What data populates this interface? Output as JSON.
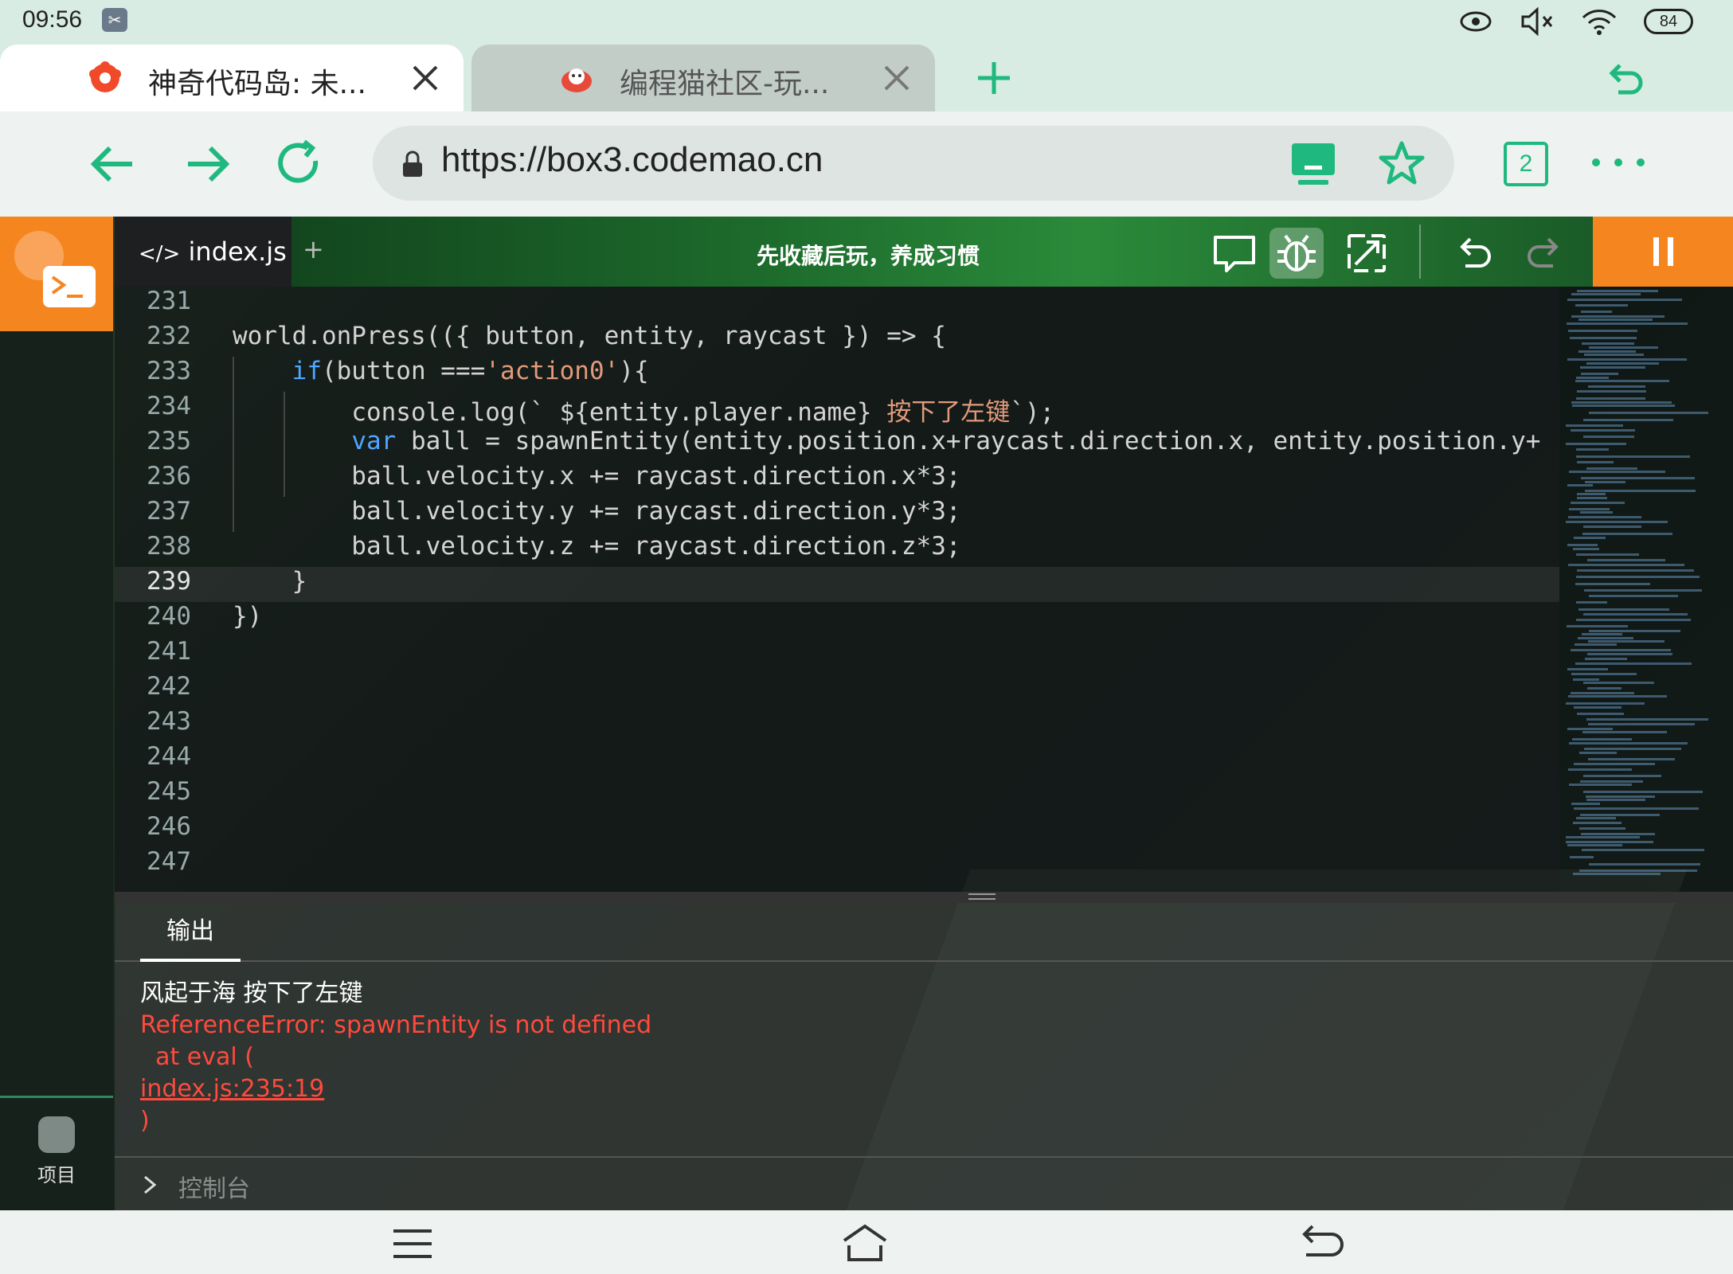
{
  "status_bar": {
    "time": "09:56",
    "battery": "84"
  },
  "tabs": [
    {
      "title": "神奇代码岛: 未...",
      "active": true
    },
    {
      "title": "编程猫社区-玩...",
      "active": false
    }
  ],
  "address_bar": {
    "url": "https://box3.codemao.cn",
    "tab_count": "2"
  },
  "editor": {
    "file_tab": "index.js",
    "new_tab_label": "+",
    "slogan": "先收藏后玩，养成习惯",
    "lines": [
      {
        "no": "231",
        "code": ""
      },
      {
        "no": "232",
        "code": "world.onPress(({ button, entity, raycast }) => {"
      },
      {
        "no": "233",
        "kw": "if",
        "pre": "    ",
        "rest1": "(button ===",
        "str": "'action0'",
        "rest2": "){"
      },
      {
        "no": "234",
        "pre": "        ",
        "rest1": "console.log(` ${entity.player.name} ",
        "cn": "按下了左键",
        "rest2": "`);"
      },
      {
        "no": "235",
        "kw": "var",
        "pre": "    ",
        "rest1": " ball = spawnEntity(entity.position.x+raycast.direction.x, entity.position.y+"
      },
      {
        "no": "236",
        "code": "        ball.velocity.x += raycast.direction.x*3;"
      },
      {
        "no": "237",
        "code": "        ball.velocity.y += raycast.direction.y*3;"
      },
      {
        "no": "238",
        "code": "        ball.velocity.z += raycast.direction.z*3;"
      },
      {
        "no": "239",
        "code": "    }"
      },
      {
        "no": "240",
        "code": "})"
      },
      {
        "no": "241",
        "code": ""
      },
      {
        "no": "242",
        "code": ""
      },
      {
        "no": "243",
        "code": ""
      },
      {
        "no": "244",
        "code": ""
      },
      {
        "no": "245",
        "code": ""
      },
      {
        "no": "246",
        "code": ""
      },
      {
        "no": "247",
        "code": ""
      }
    ],
    "current_line": "239"
  },
  "output": {
    "tab_label": "输出",
    "info_line": "风起于海 按下了左键",
    "error_line": "ReferenceError: spawnEntity is not defined",
    "at_line": "  at eval (",
    "link": "index.js:235:19",
    "close_paren": ")",
    "console_label": "控制台"
  },
  "sidebar": {
    "project_label": "项目"
  },
  "colors": {
    "accent": "#1fb97f",
    "orange": "#f5861f",
    "error": "#ff4a3d"
  }
}
